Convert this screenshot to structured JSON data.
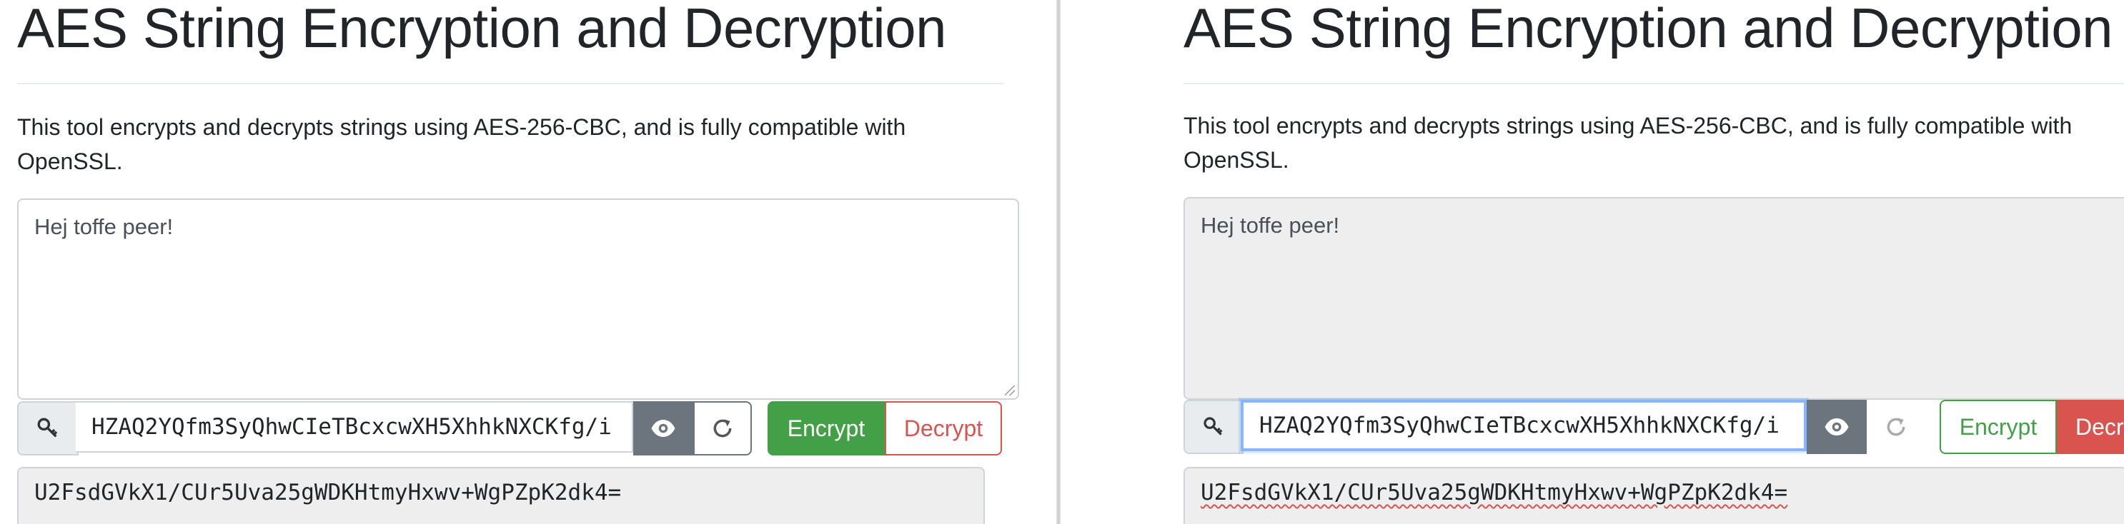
{
  "left": {
    "title": "AES String Encryption and Decryption",
    "description": "This tool encrypts and decrypts strings using AES-256-CBC, and is fully compatible with OpenSSL.",
    "input_text": "Hej toffe peer!",
    "key_value": "HZAQ2YQfm3SyQhwCIeTBcxcwXH5XhhkNXCKfg/i",
    "encrypt_label": "Encrypt",
    "decrypt_label": "Decrypt",
    "output_text": "U2FsdGVkX1/CUr5Uva25gWDKHtmyHxwv+WgPZpK2dk4="
  },
  "right": {
    "title": "AES String Encryption and Decryption",
    "description": "This tool encrypts and decrypts strings using AES-256-CBC, and is fully compatible with OpenSSL.",
    "input_text": "Hej toffe peer!",
    "key_value": "HZAQ2YQfm3SyQhwCIeTBcxcwXH5XhhkNXCKfg/i",
    "encrypt_label": "Encrypt",
    "decrypt_label": "Decrypt",
    "output_text": "U2FsdGVkX1/CUr5Uva25gWDKHtmyHxwv+WgPZpK2dk4="
  },
  "colors": {
    "success": "#43a047",
    "danger": "#d9534f",
    "secondary": "#6c757d",
    "focus": "#86b7fe"
  },
  "icons": [
    "key-icon",
    "eye-icon",
    "refresh-icon"
  ]
}
